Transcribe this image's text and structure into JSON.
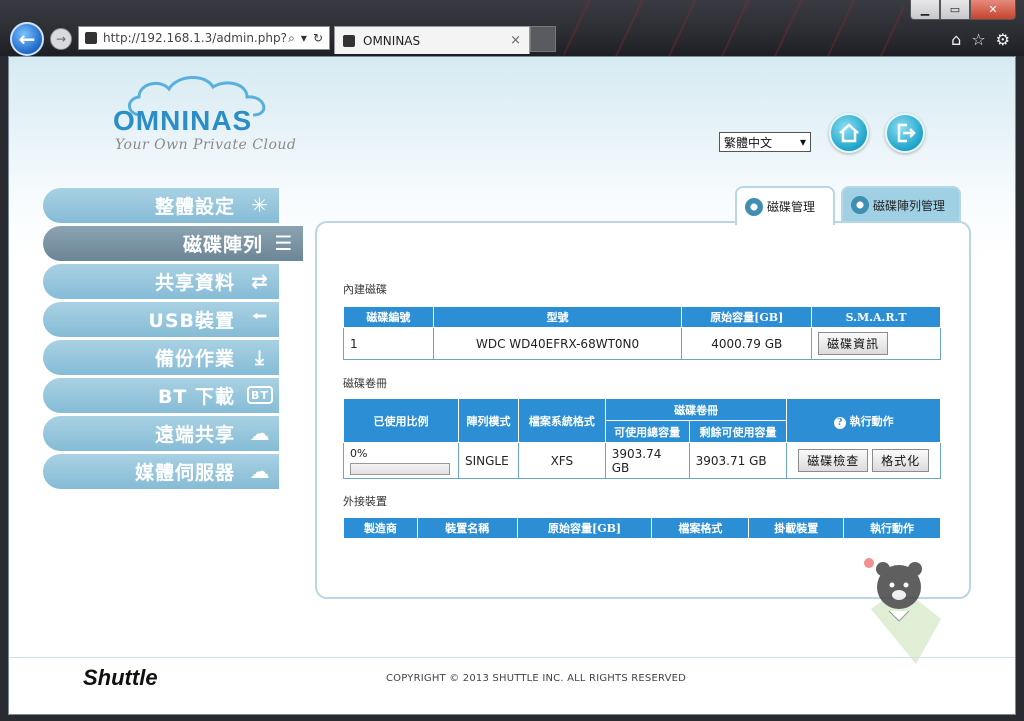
{
  "browser": {
    "url": "http://192.168.1.3/admin.php?",
    "tab_title": "OMNINAS",
    "tab_close": "×"
  },
  "header": {
    "brand": "OMNINAS",
    "tagline": "Your Own Private Cloud",
    "language": "繁體中文"
  },
  "menu": {
    "items": [
      {
        "label": "整體設定",
        "icon": "settings-icon"
      },
      {
        "label": "磁碟陣列",
        "icon": "disk-array-icon"
      },
      {
        "label": "共享資料",
        "icon": "share-arrows-icon"
      },
      {
        "label": "USB裝置",
        "icon": "usb-icon"
      },
      {
        "label": "備份作業",
        "icon": "backup-icon"
      },
      {
        "label": "BT 下載",
        "icon": "bt-icon"
      },
      {
        "label": "遠端共享",
        "icon": "remote-share-icon"
      },
      {
        "label": "媒體伺服器",
        "icon": "media-server-icon"
      }
    ]
  },
  "tabs": {
    "disk_management": "磁碟管理",
    "raid_management": "磁碟陣列管理"
  },
  "internal_disks": {
    "title": "內建磁碟",
    "headers": [
      "磁碟編號",
      "型號",
      "原始容量[GB]",
      "S.M.A.R.T"
    ],
    "rows": [
      {
        "number": "1",
        "model": "WDC WD40EFRX-68WT0N0",
        "capacity": "4000.79 GB",
        "action": "磁碟資訊"
      }
    ]
  },
  "volumes": {
    "title": "磁碟卷冊",
    "headers": {
      "usage": "已使用比例",
      "raid_mode": "陣列模式",
      "fs": "檔案系統格式",
      "volume": "磁碟卷冊",
      "total": "可使用總容量",
      "free": "剩餘可使用容量",
      "action": "執行動作"
    },
    "row": {
      "usage_text": "0%",
      "usage_fraction": 0.0,
      "raid_mode": "SINGLE",
      "fs": "XFS",
      "total": "3903.74 GB",
      "free": "3903.71 GB",
      "check_button": "磁碟檢查",
      "format_button": "格式化"
    }
  },
  "external": {
    "title": "外接裝置",
    "headers": [
      "製造商",
      "裝置名稱",
      "原始容量[GB]",
      "檔案格式",
      "掛載裝置",
      "執行動作"
    ]
  },
  "footer": {
    "brand": "Shuttle",
    "copyright": "COPYRIGHT © 2013 SHUTTLE INC. ALL RIGHTS RESERVED"
  }
}
